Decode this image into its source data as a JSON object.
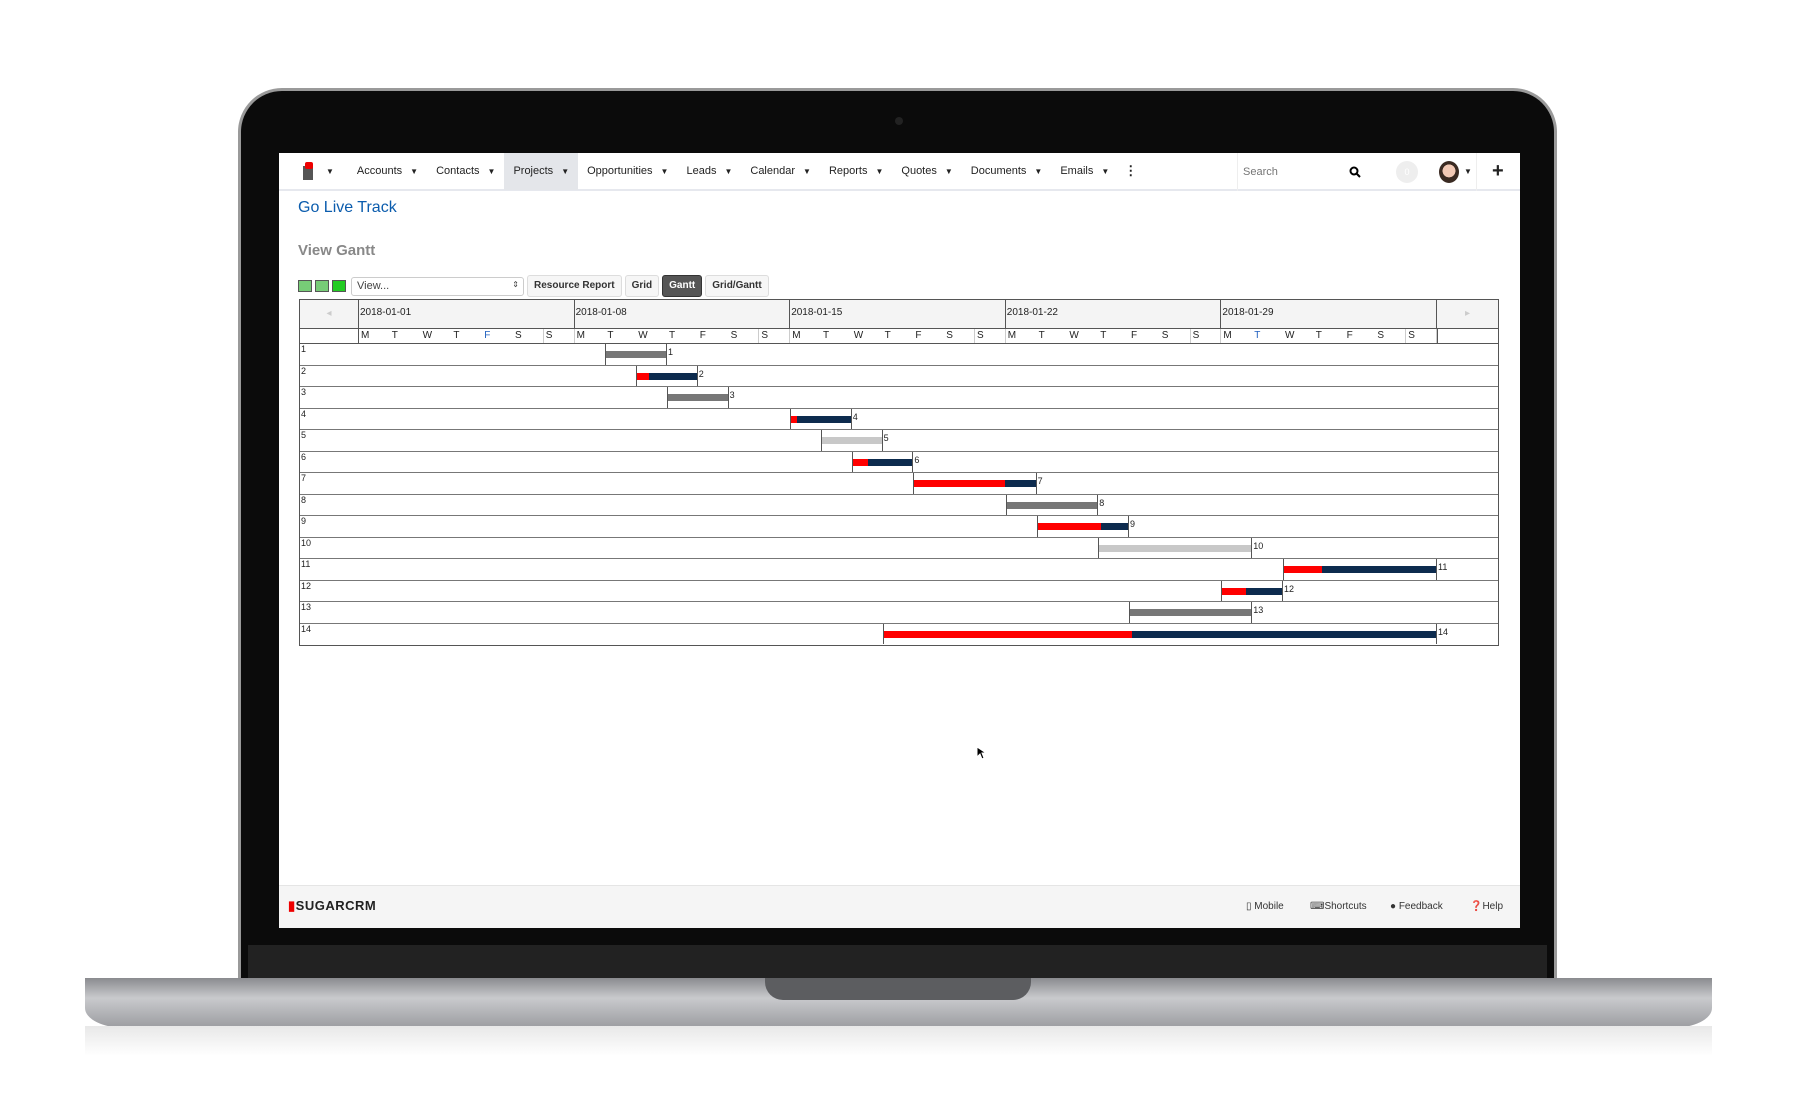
{
  "nav": {
    "items": [
      {
        "label": "Accounts",
        "active": false
      },
      {
        "label": "Contacts",
        "active": false
      },
      {
        "label": "Projects",
        "active": true
      },
      {
        "label": "Opportunities",
        "active": false
      },
      {
        "label": "Leads",
        "active": false
      },
      {
        "label": "Calendar",
        "active": false
      },
      {
        "label": "Reports",
        "active": false
      },
      {
        "label": "Quotes",
        "active": false
      },
      {
        "label": "Documents",
        "active": false
      },
      {
        "label": "Emails",
        "active": false
      }
    ],
    "search_placeholder": "Search",
    "notification_count": "0"
  },
  "page": {
    "title": "Go Live Track",
    "subtitle": "View Gantt"
  },
  "toolbar": {
    "view_select": "View...",
    "buttons": [
      "Resource Report",
      "Grid",
      "Gantt",
      "Grid/Gantt"
    ],
    "active_button": "Gantt"
  },
  "gantt": {
    "weeks": [
      "2018-01-01",
      "2018-01-08",
      "2018-01-15",
      "2018-01-22",
      "2018-01-29"
    ],
    "weekdays": [
      "M",
      "T",
      "W",
      "T",
      "F",
      "S",
      "S"
    ],
    "highlighted_days": [
      4,
      29
    ],
    "colors": {
      "done": "#ff0000",
      "remaining": "#0d2b4e",
      "task_dark": "#777777",
      "task_light": "#c8c8c8",
      "highlight": "#1f5fbf"
    },
    "tasks": [
      {
        "id": "1",
        "start": 8,
        "duration": 2,
        "style": "dark"
      },
      {
        "id": "2",
        "start": 9,
        "duration": 2,
        "style": "progress",
        "progress": 0.2
      },
      {
        "id": "3",
        "start": 10,
        "duration": 2,
        "style": "dark"
      },
      {
        "id": "4",
        "start": 14,
        "duration": 2,
        "style": "progress",
        "progress": 0.1
      },
      {
        "id": "5",
        "start": 15,
        "duration": 2,
        "style": "light"
      },
      {
        "id": "6",
        "start": 16,
        "duration": 2,
        "style": "progress",
        "progress": 0.25
      },
      {
        "id": "7",
        "start": 18,
        "duration": 4,
        "style": "progress",
        "progress": 0.75
      },
      {
        "id": "8",
        "start": 21,
        "duration": 3,
        "style": "dark"
      },
      {
        "id": "9",
        "start": 22,
        "duration": 3,
        "style": "progress",
        "progress": 0.7
      },
      {
        "id": "10",
        "start": 24,
        "duration": 5,
        "style": "light"
      },
      {
        "id": "11",
        "start": 30,
        "duration": 5,
        "style": "progress",
        "progress": 0.25
      },
      {
        "id": "12",
        "start": 28,
        "duration": 2,
        "style": "progress",
        "progress": 0.4
      },
      {
        "id": "13",
        "start": 25,
        "duration": 4,
        "style": "dark"
      },
      {
        "id": "14",
        "start": 17,
        "duration": 18,
        "style": "progress",
        "progress": 0.45
      }
    ]
  },
  "footer": {
    "brand": "SUGARCRM",
    "links": [
      "Mobile",
      "Shortcuts",
      "Feedback",
      "Help"
    ]
  }
}
